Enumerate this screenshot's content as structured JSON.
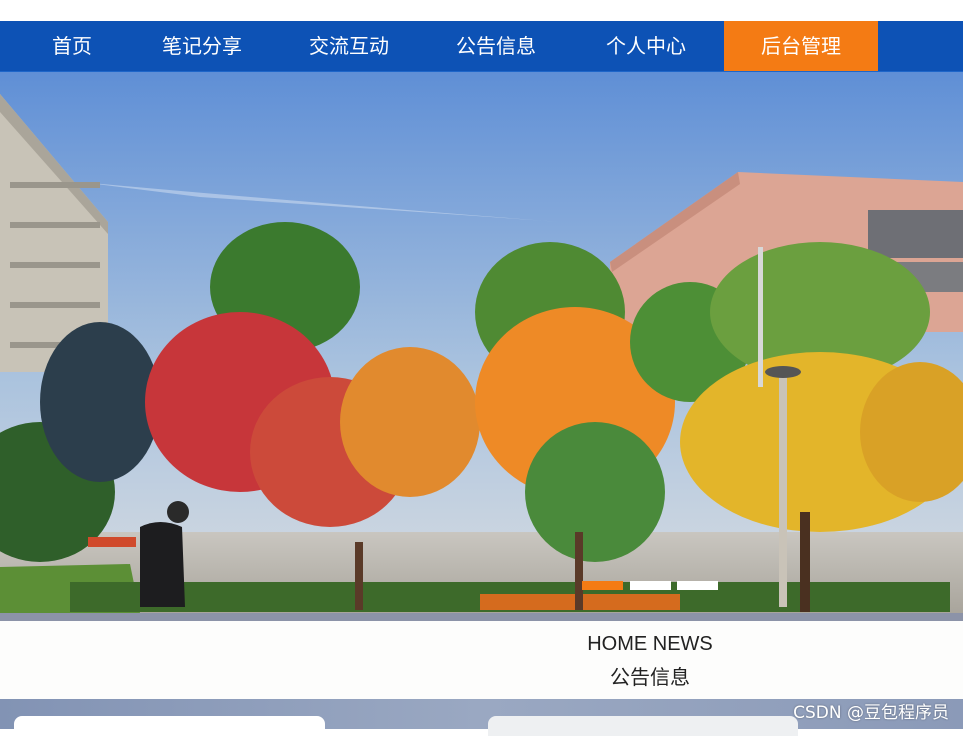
{
  "nav": {
    "items": [
      {
        "label": "首页"
      },
      {
        "label": "笔记分享"
      },
      {
        "label": "交流互动"
      },
      {
        "label": "公告信息"
      },
      {
        "label": "个人中心"
      },
      {
        "label": "后台管理"
      }
    ],
    "active_index": 5,
    "colors": {
      "bar": "#0d52b5",
      "active": "#f47b14"
    }
  },
  "banner": {
    "slide_count": 3,
    "active_slide": 1
  },
  "news": {
    "title_en": "HOME NEWS",
    "title_cn": "公告信息"
  },
  "watermark": "CSDN @豆包程序员"
}
